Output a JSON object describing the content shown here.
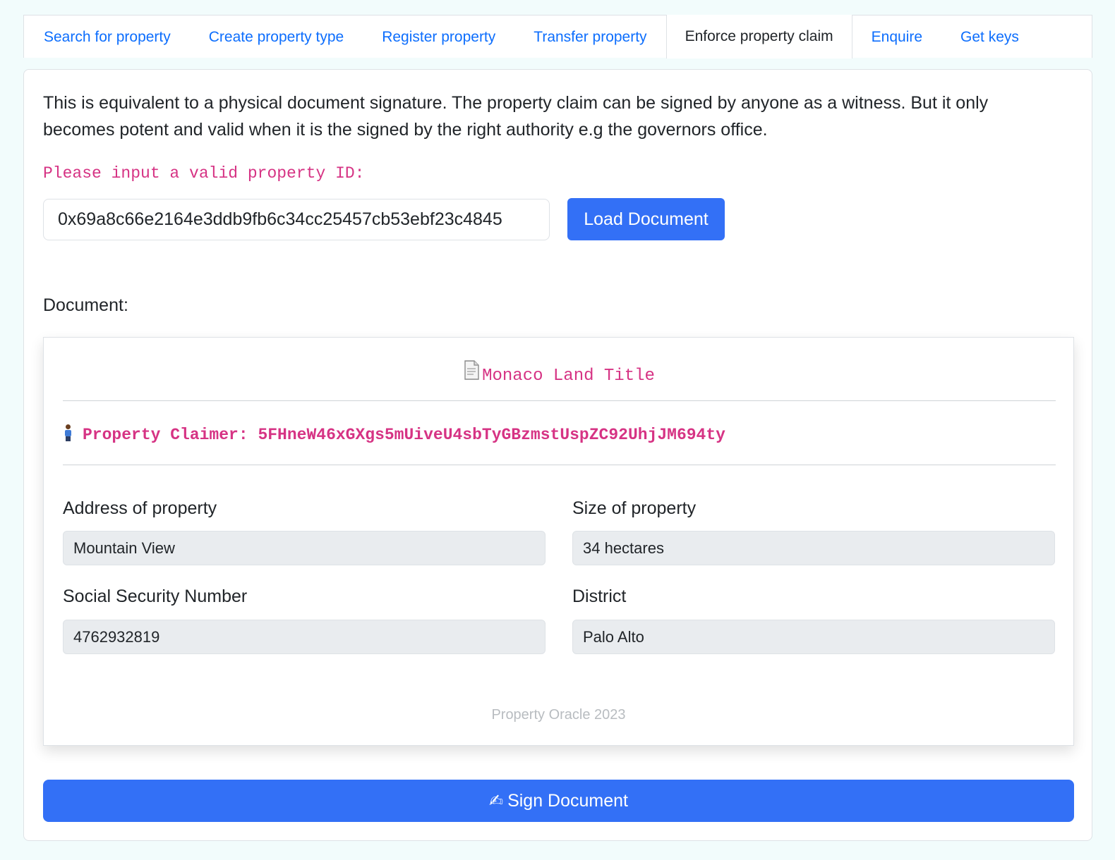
{
  "tabs": [
    {
      "label": "Search for property",
      "active": false
    },
    {
      "label": "Create property type",
      "active": false
    },
    {
      "label": "Register property",
      "active": false
    },
    {
      "label": "Transfer property",
      "active": false
    },
    {
      "label": "Enforce property claim",
      "active": true
    },
    {
      "label": "Enquire",
      "active": false
    },
    {
      "label": "Get keys",
      "active": false
    }
  ],
  "intro_text": "This is equivalent to a physical document signature. The property claim can be signed by anyone as a witness. But it only becomes potent and valid when it is the signed by the right authority e.g the governors office.",
  "property_id": {
    "label": "Please input a valid property ID:",
    "value": "0x69a8c66e2164e3ddb9fb6c34cc25457cb53ebf23c4845"
  },
  "load_button": "Load Document",
  "document_label": "Document:",
  "document": {
    "icon": "document-icon",
    "title": "Monaco Land Title",
    "claimer_icon": "person-icon",
    "claimer_label": "Property Claimer:",
    "claimer_value": "5FHneW46xGXgs5mUiveU4sbTyGBzmstUspZC92UhjJM694ty",
    "fields": {
      "address": {
        "label": "Address of property",
        "value": "Mountain View"
      },
      "size": {
        "label": "Size of property",
        "value": "34 hectares"
      },
      "ssn": {
        "label": "Social Security Number",
        "value": "4762932819"
      },
      "district": {
        "label": "District",
        "value": "Palo Alto"
      }
    },
    "footer": "Property Oracle 2023"
  },
  "sign_button": {
    "icon": "writing-hand-icon",
    "label": "Sign Document"
  },
  "colors": {
    "accent": "#3370f6",
    "link": "#0d6efd",
    "code_pink": "#d63384",
    "page_background": "#f2fcfc"
  }
}
